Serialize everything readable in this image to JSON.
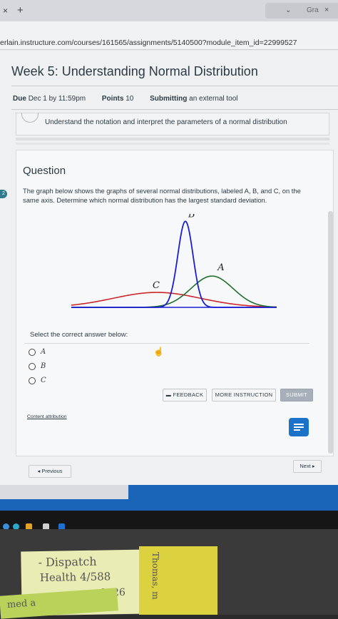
{
  "browser": {
    "tab_close": "×",
    "new_tab": "+",
    "right_tab_chevron": "⌄",
    "right_tab_label": "Gra",
    "right_tab_close": "×",
    "url": "erlain.instructure.com/courses/161565/assignments/5140500?module_item_id=22999527"
  },
  "assignment": {
    "title": "Week 5: Understanding Normal Distribution",
    "due_label": "Due",
    "due_value": "Dec 1 by 11:59pm",
    "points_label": "Points",
    "points_value": "10",
    "submitting_label": "Submitting",
    "submitting_value": "an external tool",
    "objective": "Understand the notation and interpret the parameters of a normal distribution"
  },
  "question": {
    "heading": "Question",
    "side_badge": "2",
    "text": "The graph below shows the graphs of several normal distributions, labeled A, B, and C, on the same axis. Determine which normal distribution has the largest standard deviation.",
    "select_label": "Select the correct answer below:",
    "options": [
      {
        "label": "A"
      },
      {
        "label": "B"
      },
      {
        "label": "C"
      }
    ],
    "feedback_label": "FEEDBACK",
    "more_instruction_label": "MORE INSTRUCTION",
    "submit_label": "SUBMIT",
    "attribution": "Content attribution"
  },
  "chart_data": {
    "type": "line",
    "title": "",
    "xlabel": "",
    "ylabel": "",
    "grid": false,
    "legend": "none",
    "series": [
      {
        "name": "A",
        "mean": 0.7,
        "sd": 0.55,
        "color": "#1f6e2a"
      },
      {
        "name": "B",
        "mean": 0.0,
        "sd": 0.2,
        "color": "#1a1fd1"
      },
      {
        "name": "C",
        "mean": -0.75,
        "sd": 1.15,
        "color": "#c8262a"
      }
    ],
    "xlim": [
      -3.0,
      2.4
    ],
    "ylim": [
      0,
      2.0
    ]
  },
  "navigation": {
    "previous_label": "◂ Previous",
    "next_label": "Next ▸"
  },
  "desk_notes": {
    "note1_line1": "- Dispatch",
    "note1_line2": "Health 4/588",
    "note1_line3": "9626",
    "note2_text": "Thomas, m",
    "note3_text": "med a"
  },
  "colors": {
    "accent": "#1a73c9",
    "text": "#2d3b45"
  }
}
